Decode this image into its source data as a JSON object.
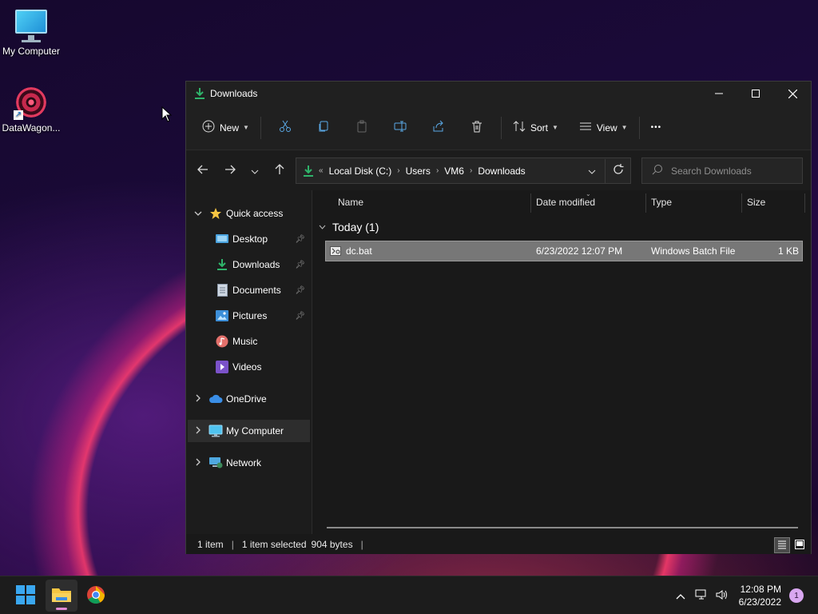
{
  "desktop": {
    "icons": [
      {
        "label": "My Computer"
      },
      {
        "label": "DataWagon..."
      }
    ]
  },
  "window": {
    "title": "Downloads",
    "controls": {
      "minimize": "—",
      "maximize": "☐",
      "close": "✕"
    }
  },
  "toolbar": {
    "new_label": "New",
    "sort_label": "Sort",
    "view_label": "View",
    "more_label": "•••"
  },
  "address": {
    "overflow": "«",
    "crumbs": [
      "Local Disk (C:)",
      "Users",
      "VM6",
      "Downloads"
    ],
    "search_placeholder": "Search Downloads"
  },
  "navpane": {
    "quick_access": "Quick access",
    "items": [
      {
        "label": "Desktop",
        "pinned": true
      },
      {
        "label": "Downloads",
        "pinned": true
      },
      {
        "label": "Documents",
        "pinned": true
      },
      {
        "label": "Pictures",
        "pinned": true
      },
      {
        "label": "Music",
        "pinned": false
      },
      {
        "label": "Videos",
        "pinned": false
      }
    ],
    "onedrive": "OneDrive",
    "my_computer": "My Computer",
    "network": "Network"
  },
  "columns": [
    "Name",
    "Date modified",
    "Type",
    "Size"
  ],
  "groups": [
    {
      "label": "Today (1)",
      "files": [
        {
          "name": "dc.bat",
          "date": "6/23/2022 12:07 PM",
          "type": "Windows Batch File",
          "size": "1 KB"
        }
      ]
    }
  ],
  "status": {
    "count": "1 item",
    "selection": "1 item selected",
    "bytes": "904 bytes"
  },
  "taskbar": {
    "time": "12:08 PM",
    "date": "6/23/2022",
    "notifications": "1"
  },
  "colors": {
    "accent_green": "#2fb36a",
    "folder_yellow": "#f5c542",
    "selection_gray": "#777777"
  }
}
